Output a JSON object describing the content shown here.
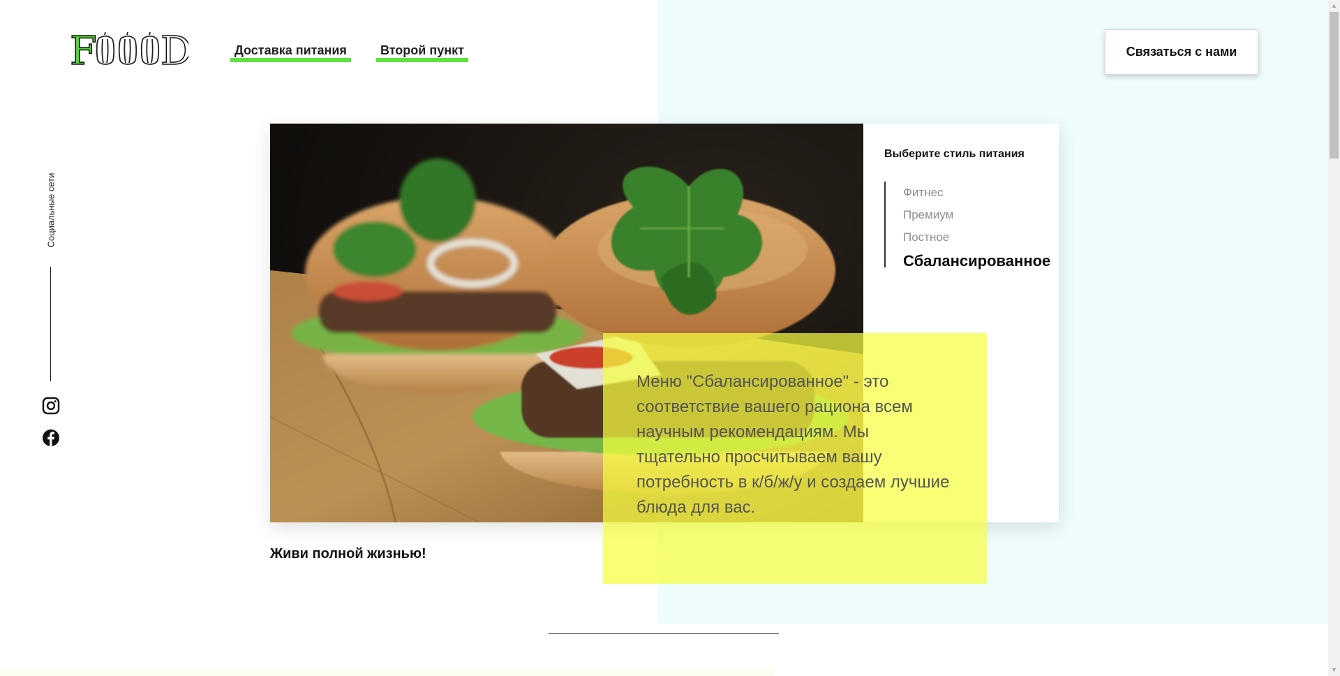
{
  "header": {
    "logo_text": "FOOD",
    "nav": [
      {
        "label": "Доставка питания"
      },
      {
        "label": "Второй пункт"
      }
    ],
    "contact_label": "Связаться с нами"
  },
  "sidebar": {
    "social_label": "Социальные сети",
    "icons": [
      "instagram-icon",
      "facebook-icon"
    ]
  },
  "diet": {
    "title": "Выберите стиль питания",
    "options": [
      {
        "label": "Фитнес"
      },
      {
        "label": "Премиум"
      },
      {
        "label": "Постное"
      },
      {
        "label": "Сбалансированное"
      }
    ],
    "selected": "Сбалансированное",
    "description": "Меню \"Сбалансированное\" - это соответствие вашего рациона всем научным рекомендациям. Мы тщательно просчитываем вашу потребность в к/б/ж/у и создаем лучшие блюда для вас."
  },
  "tagline": "Живи полной жизнью!",
  "colors": {
    "accent_green": "#5de33e",
    "highlight_yellow": "#f6ff40",
    "light_cyan_bg": "#effcfc"
  }
}
